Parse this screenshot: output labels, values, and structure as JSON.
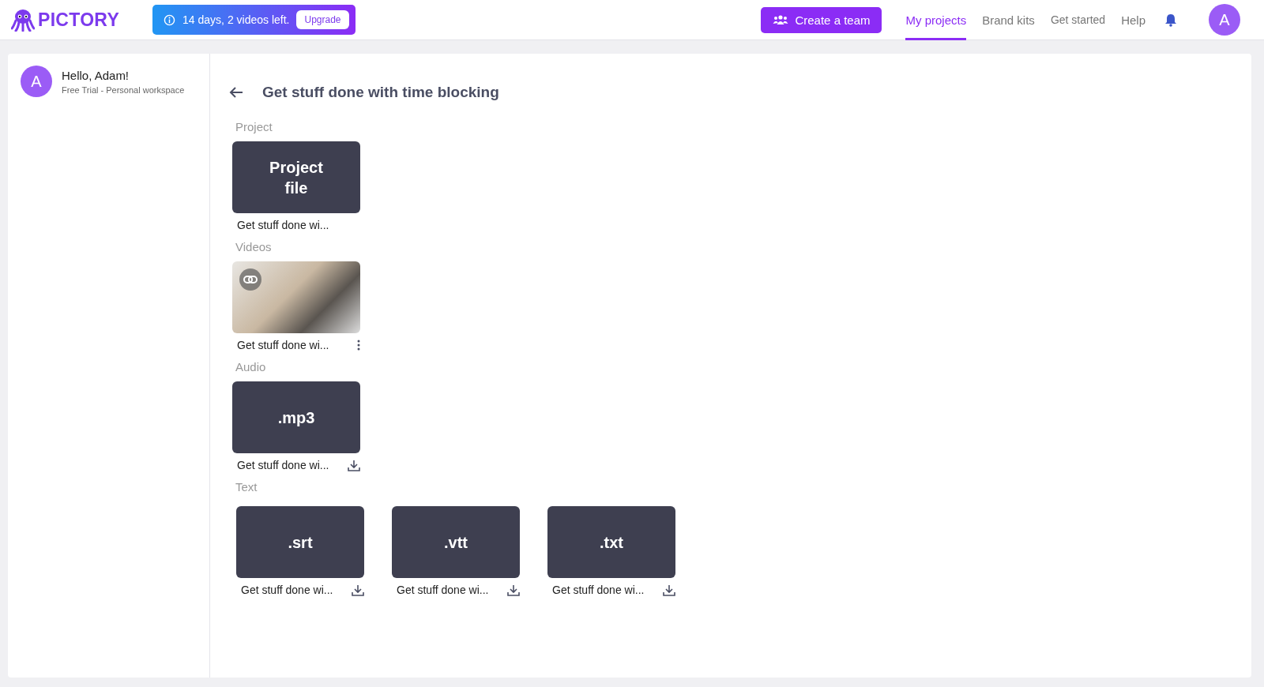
{
  "header": {
    "logo": "PICTORY",
    "trial_banner": {
      "text": "14 days, 2 videos left.",
      "button": "Upgrade"
    },
    "create_team": "Create a team",
    "nav": [
      {
        "label": "My projects",
        "selected": true
      },
      {
        "label": "Brand kits",
        "selected": false
      },
      {
        "label": "Get started",
        "selected": false
      },
      {
        "label": "Help",
        "selected": false
      }
    ],
    "avatar": "A"
  },
  "sidebar": {
    "avatar": "A",
    "greeting": "Hello, Adam!",
    "plan": "Free Trial - Personal workspace"
  },
  "page": {
    "title": "Get stuff done with time blocking",
    "sections": [
      {
        "label": "Project",
        "files": [
          {
            "kind": "tile",
            "tile_text": "Project file",
            "name": "Get stuff done wi...",
            "menu": false,
            "download": false
          }
        ]
      },
      {
        "label": "Videos",
        "files": [
          {
            "kind": "video",
            "name": "Get stuff done wi...",
            "menu": true,
            "download": false
          }
        ]
      },
      {
        "label": "Audio",
        "files": [
          {
            "kind": "tile",
            "tile_text": ".mp3",
            "name": "Get stuff done wi...",
            "menu": false,
            "download": true
          }
        ]
      },
      {
        "label": "Text",
        "files": [
          {
            "kind": "tile",
            "tile_text": ".srt",
            "name": "Get stuff done wi...",
            "menu": false,
            "download": true
          },
          {
            "kind": "tile",
            "tile_text": ".vtt",
            "name": "Get stuff done wi...",
            "menu": false,
            "download": true
          },
          {
            "kind": "tile",
            "tile_text": ".txt",
            "name": "Get stuff done wi...",
            "menu": false,
            "download": true
          }
        ]
      }
    ]
  }
}
